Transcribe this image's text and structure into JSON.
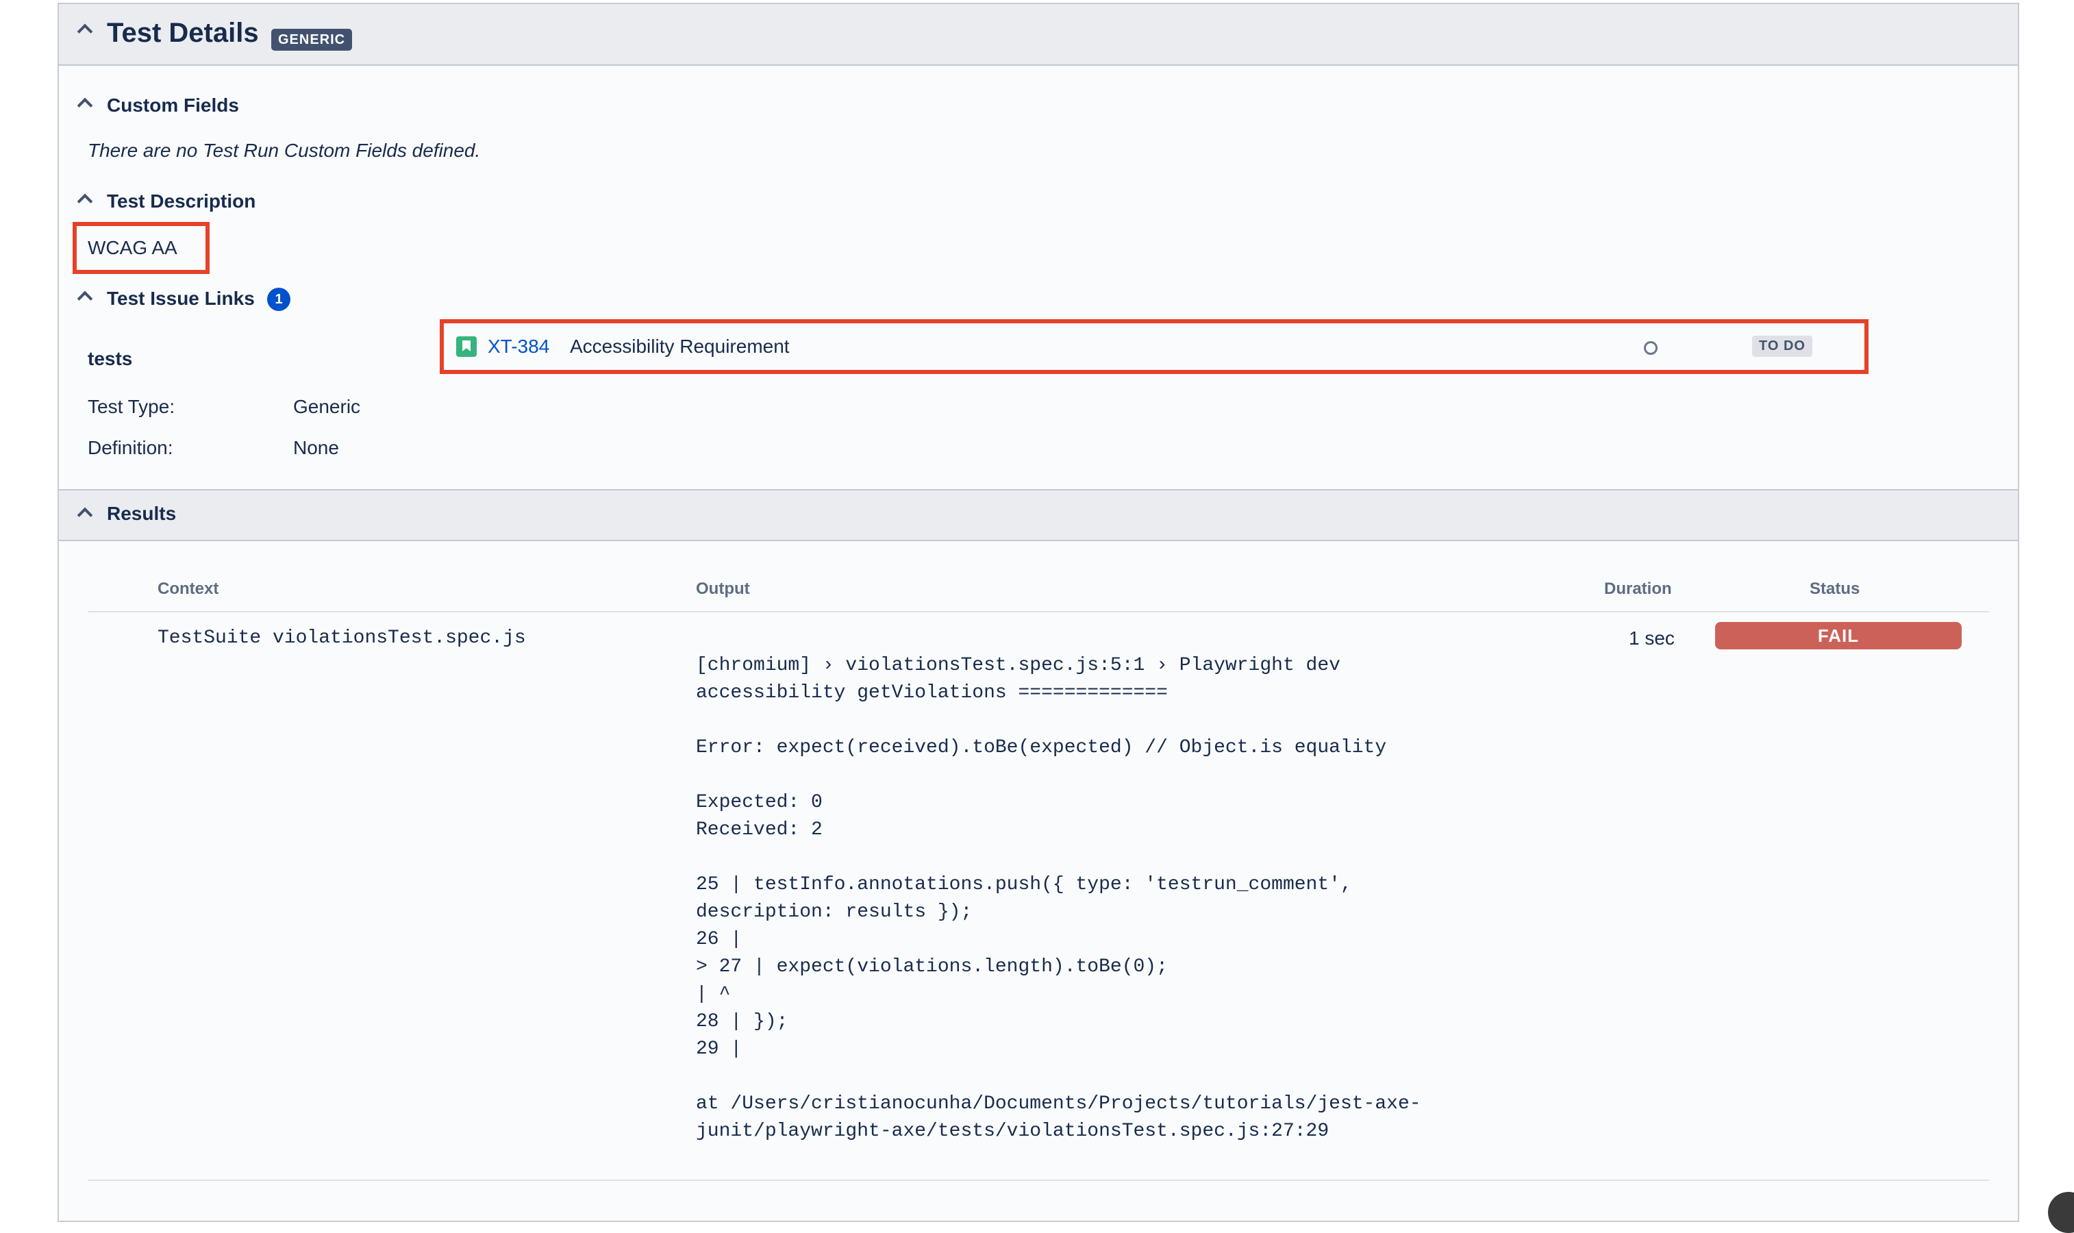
{
  "header": {
    "title": "Test Details",
    "type_badge": "GENERIC"
  },
  "custom_fields": {
    "title": "Custom Fields",
    "empty_text": "There are no Test Run Custom Fields defined."
  },
  "test_description": {
    "title": "Test Description",
    "value": "WCAG AA"
  },
  "test_issue_links": {
    "title": "Test Issue Links",
    "count": "1",
    "group_label": "tests",
    "issue": {
      "key": "XT-384",
      "summary": "Accessibility Requirement",
      "status": "TO DO",
      "icon": "story-bookmark-icon"
    },
    "fields": [
      {
        "label": "Test Type:",
        "value": "Generic"
      },
      {
        "label": "Definition:",
        "value": "None"
      }
    ]
  },
  "results": {
    "title": "Results",
    "columns": {
      "context": "Context",
      "output": "Output",
      "duration": "Duration",
      "status": "Status"
    },
    "rows": [
      {
        "context": "TestSuite violationsTest.spec.js",
        "duration": "1 sec",
        "status": "FAIL",
        "output": [
          "[chromium] › violationsTest.spec.js:5:1 › Playwright dev",
          "accessibility getViolations =============",
          "",
          "Error: expect(received).toBe(expected) // Object.is equality",
          "",
          "Expected: 0",
          "Received: 2",
          "",
          "25 | testInfo.annotations.push({ type: 'testrun_comment',",
          "description: results });",
          "26 |",
          "> 27 | expect(violations.length).toBe(0);",
          "| ^",
          "28 | });",
          "29 |",
          "",
          "at /Users/cristianocunha/Documents/Projects/tutorials/jest-axe-",
          "junit/playwright-axe/tests/violationsTest.spec.js:27:29"
        ]
      }
    ]
  },
  "colors": {
    "header_bg": "#ebecf0",
    "highlight": "#e5422a",
    "link": "#0052cc",
    "fail": "#cc6158",
    "issue_icon": "#36b37e"
  }
}
